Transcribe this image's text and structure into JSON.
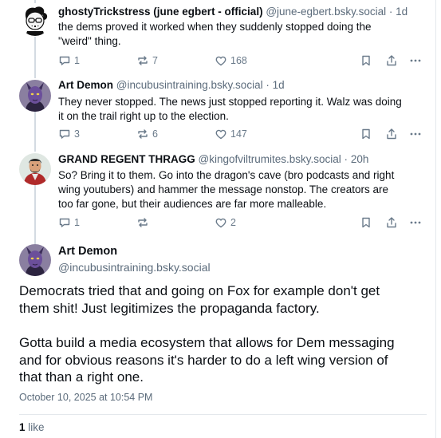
{
  "posts": [
    {
      "display_name": "ghostyTrickstress (june egbert - official)",
      "handle": "@june-egbert.bsky.social",
      "separator": "·",
      "time": "1d",
      "text_lines": [
        "the dems proved it worked when they suddenly stopped doing the",
        "\"weird\" thing."
      ],
      "replies": "1",
      "reposts": "7",
      "likes": "168"
    },
    {
      "display_name": "Art Demon",
      "handle": "@incubusintraining.bsky.social",
      "separator": "·",
      "time": "1d",
      "text_lines": [
        "They never stopped. The news just stopped reporting it. Walz was doing",
        "it on the trail right up to the election."
      ],
      "replies": "3",
      "reposts": "6",
      "likes": "147"
    },
    {
      "display_name": "GRAND REGENT THRAGG",
      "handle": "@kingofviltrumites.bsky.social",
      "separator": "·",
      "time": "20h",
      "text_lines": [
        "So? Bring it to them. Go into the dragon's cave (bro podcasts and right",
        "wing youtubers) and hammer the message nonstop. The creators are",
        "too far gone, but their audiences are far more malleable."
      ],
      "replies": "1",
      "reposts": "",
      "likes": "2"
    }
  ],
  "main_post": {
    "display_name": "Art Demon",
    "handle": "@incubusintraining.bsky.social",
    "paragraph1_lines": [
      "Democrats tried that and going on Fox for example don't get",
      "them shit! Just legitimizes the propaganda factory."
    ],
    "paragraph2_lines": [
      "Gotta build a media ecosystem that allows for Dem messaging",
      "and for obvious reasons it's harder to do a left wing version of",
      "that than a right one."
    ],
    "timestamp": "October 10, 2025 at 10:54 PM",
    "like_count": "1",
    "like_label": "like"
  },
  "colors": {
    "text": "#0b0f14",
    "muted": "#5b6b7b",
    "icon": "#6a7a8a",
    "thread_line": "#d4dbe2"
  }
}
